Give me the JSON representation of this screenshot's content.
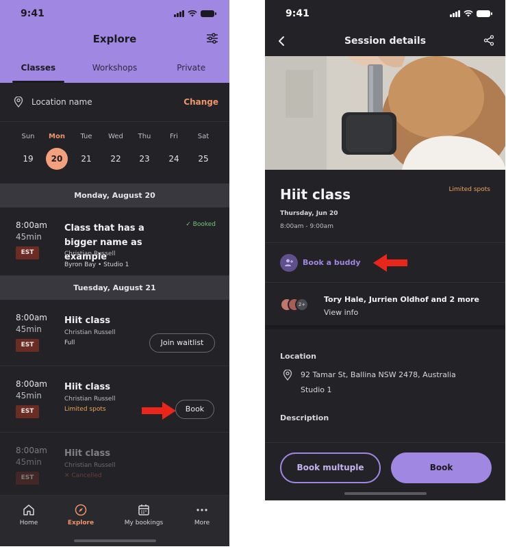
{
  "left": {
    "status_time": "9:41",
    "title": "Explore",
    "tabs": [
      "Classes",
      "Workshops",
      "Private"
    ],
    "location": {
      "label": "Location name",
      "action": "Change"
    },
    "calendar": [
      {
        "name": "Sun",
        "num": "19"
      },
      {
        "name": "Mon",
        "num": "20",
        "selected": true
      },
      {
        "name": "Tue",
        "num": "21"
      },
      {
        "name": "Wed",
        "num": "22"
      },
      {
        "name": "Thu",
        "num": "23"
      },
      {
        "name": "Fri",
        "num": "24"
      },
      {
        "name": "Sat",
        "num": "25"
      }
    ],
    "date_headers": [
      "Monday, August 20",
      "Tuesday, August 21"
    ],
    "sessions": [
      {
        "time": "8:00am",
        "duration": "45min",
        "tz": "EST",
        "title": "Class that has a bigger name as example",
        "trainer": "Christian Russell",
        "meta": "Byron Bay • Studio 1",
        "status": "✓ Booked"
      },
      {
        "time": "8:00am",
        "duration": "45min",
        "tz": "EST",
        "title": "Hiit class",
        "trainer": "Christian Russell",
        "meta": "Full",
        "action": "Join waitlist"
      },
      {
        "time": "8:00am",
        "duration": "45min",
        "tz": "EST",
        "title": "Hiit class",
        "trainer": "Christian Russell",
        "meta": "Limited spots",
        "action": "Book"
      },
      {
        "time": "8:00am",
        "duration": "45min",
        "tz": "EST",
        "title": "Hiit class",
        "trainer": "Christian Russell",
        "meta": "✕ Cancelled"
      }
    ],
    "nav": [
      "Home",
      "Explore",
      "My bookings",
      "More"
    ]
  },
  "right": {
    "status_time": "9:41",
    "title": "Session details",
    "class_title": "Hiit class",
    "limited": "Limited spots",
    "date": "Thursday, Jun 20",
    "time_range": "8:00am - 9:00am",
    "buddy": "Book a buddy",
    "avatars_more": "2+",
    "attendees": "Tory Hale, Jurrien Oldhof and 2 more",
    "view_info": "View info",
    "location_label": "Location",
    "address_line1": "92 Tamar St, Ballina NSW 2478, Australia",
    "address_line2": "Studio 1",
    "description_label": "Description",
    "btn_multiple": "Book multuple",
    "btn_book": "Book"
  },
  "colors": {
    "accent": "#9f87e2",
    "orange": "#f0946a",
    "annotation_arrow": "#e8261c"
  }
}
